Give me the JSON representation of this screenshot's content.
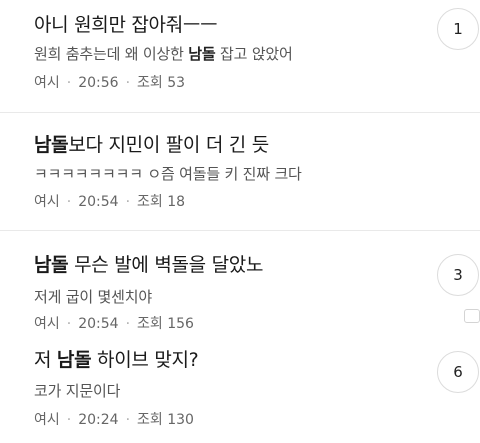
{
  "posts": [
    {
      "title_pre": "아니 원희만 잡아줘ㅡㅡ",
      "title_bold": "",
      "title_post": "",
      "preview_pre": "원희 춤추는데 왜 이상한 ",
      "preview_bold": "남돌",
      "preview_post": " 잡고 앉았어",
      "author": "여시",
      "time": "20:56",
      "views": "조회 53",
      "comments": "1"
    },
    {
      "title_pre": "",
      "title_bold": "남돌",
      "title_post": "보다 지민이 팔이 더 긴 듯",
      "preview_pre": "ㅋㅋㅋㅋㅋㅋㅋㅋ ㅇ즘 여돌들 키 진짜 크다",
      "preview_bold": "",
      "preview_post": "",
      "author": "여시",
      "time": "20:54",
      "views": "조회 18",
      "comments": ""
    },
    {
      "title_pre": "",
      "title_bold": "남돌",
      "title_post": " 무슨 발에 벽돌을 달았노",
      "preview_pre": "저게 굽이 몇센치야",
      "preview_bold": "",
      "preview_post": "",
      "author": "여시",
      "time": "20:54",
      "views": "조회 156",
      "comments": "3"
    },
    {
      "title_pre": "저 ",
      "title_bold": "남돌",
      "title_post": " 하이브 맞지?",
      "preview_pre": "코가 지문이다",
      "preview_bold": "",
      "preview_post": "",
      "author": "여시",
      "time": "20:24",
      "views": "조회 130",
      "comments": "6"
    }
  ],
  "icons": {
    "side": "chat-icon"
  }
}
